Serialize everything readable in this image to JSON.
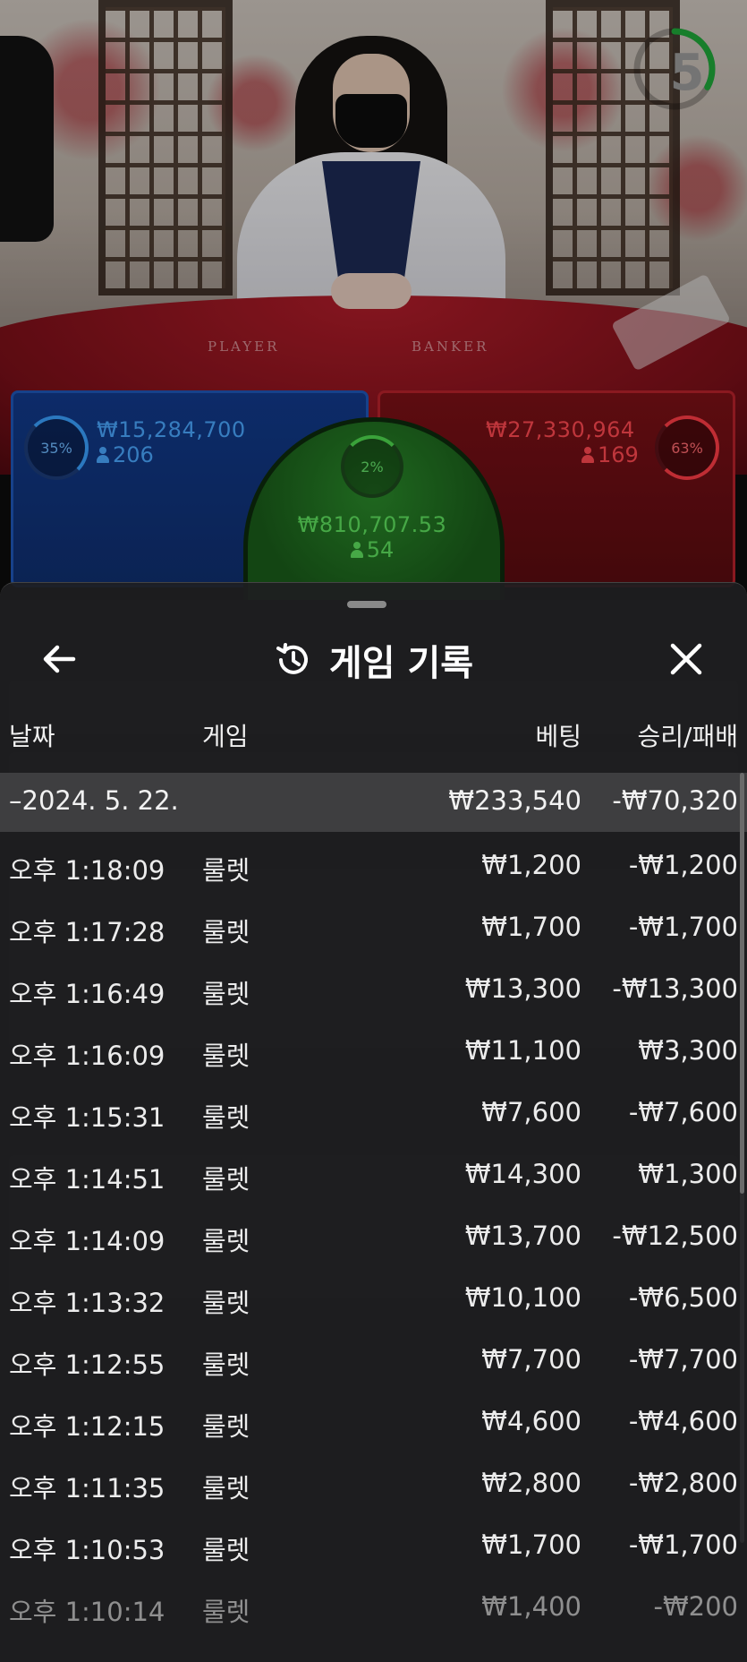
{
  "timer": {
    "value": "5",
    "progress": 0.33,
    "color": "#1fa83a"
  },
  "bets": {
    "player": {
      "percent": "35%",
      "amount": "₩15,284,700",
      "players": "206",
      "color": "#3aa1ff"
    },
    "tie": {
      "percent": "2%",
      "amount": "₩810,707.53",
      "players": "54",
      "color": "#4ed84e"
    },
    "banker": {
      "percent": "63%",
      "amount": "₩27,330,964",
      "players": "169",
      "color": "#ff3d46"
    }
  },
  "table_labels": {
    "player": "PLAYER",
    "banker": "BANKER"
  },
  "history": {
    "title": "게임 기록",
    "icons": {
      "back": "arrow-left-icon",
      "history": "history-icon",
      "close": "close-icon"
    },
    "columns": {
      "date": "날짜",
      "game": "게임",
      "bet": "베팅",
      "result": "승리/패배"
    },
    "day": {
      "date": "–2024. 5. 22.",
      "bet": "₩233,540",
      "result": "-₩70,320"
    },
    "rows": [
      {
        "time": "오후 1:18:09",
        "game": "룰렛",
        "bet": "₩1,200",
        "result": "-₩1,200"
      },
      {
        "time": "오후 1:17:28",
        "game": "룰렛",
        "bet": "₩1,700",
        "result": "-₩1,700"
      },
      {
        "time": "오후 1:16:49",
        "game": "룰렛",
        "bet": "₩13,300",
        "result": "-₩13,300"
      },
      {
        "time": "오후 1:16:09",
        "game": "룰렛",
        "bet": "₩11,100",
        "result": "₩3,300"
      },
      {
        "time": "오후 1:15:31",
        "game": "룰렛",
        "bet": "₩7,600",
        "result": "-₩7,600"
      },
      {
        "time": "오후 1:14:51",
        "game": "룰렛",
        "bet": "₩14,300",
        "result": "₩1,300"
      },
      {
        "time": "오후 1:14:09",
        "game": "룰렛",
        "bet": "₩13,700",
        "result": "-₩12,500"
      },
      {
        "time": "오후 1:13:32",
        "game": "룰렛",
        "bet": "₩10,100",
        "result": "-₩6,500"
      },
      {
        "time": "오후 1:12:55",
        "game": "룰렛",
        "bet": "₩7,700",
        "result": "-₩7,700"
      },
      {
        "time": "오후 1:12:15",
        "game": "룰렛",
        "bet": "₩4,600",
        "result": "-₩4,600"
      },
      {
        "time": "오후 1:11:35",
        "game": "룰렛",
        "bet": "₩2,800",
        "result": "-₩2,800"
      },
      {
        "time": "오후 1:10:53",
        "game": "룰렛",
        "bet": "₩1,700",
        "result": "-₩1,700"
      },
      {
        "time": "오후 1:10:14",
        "game": "룰렛",
        "bet": "₩1,400",
        "result": "-₩200"
      }
    ]
  }
}
